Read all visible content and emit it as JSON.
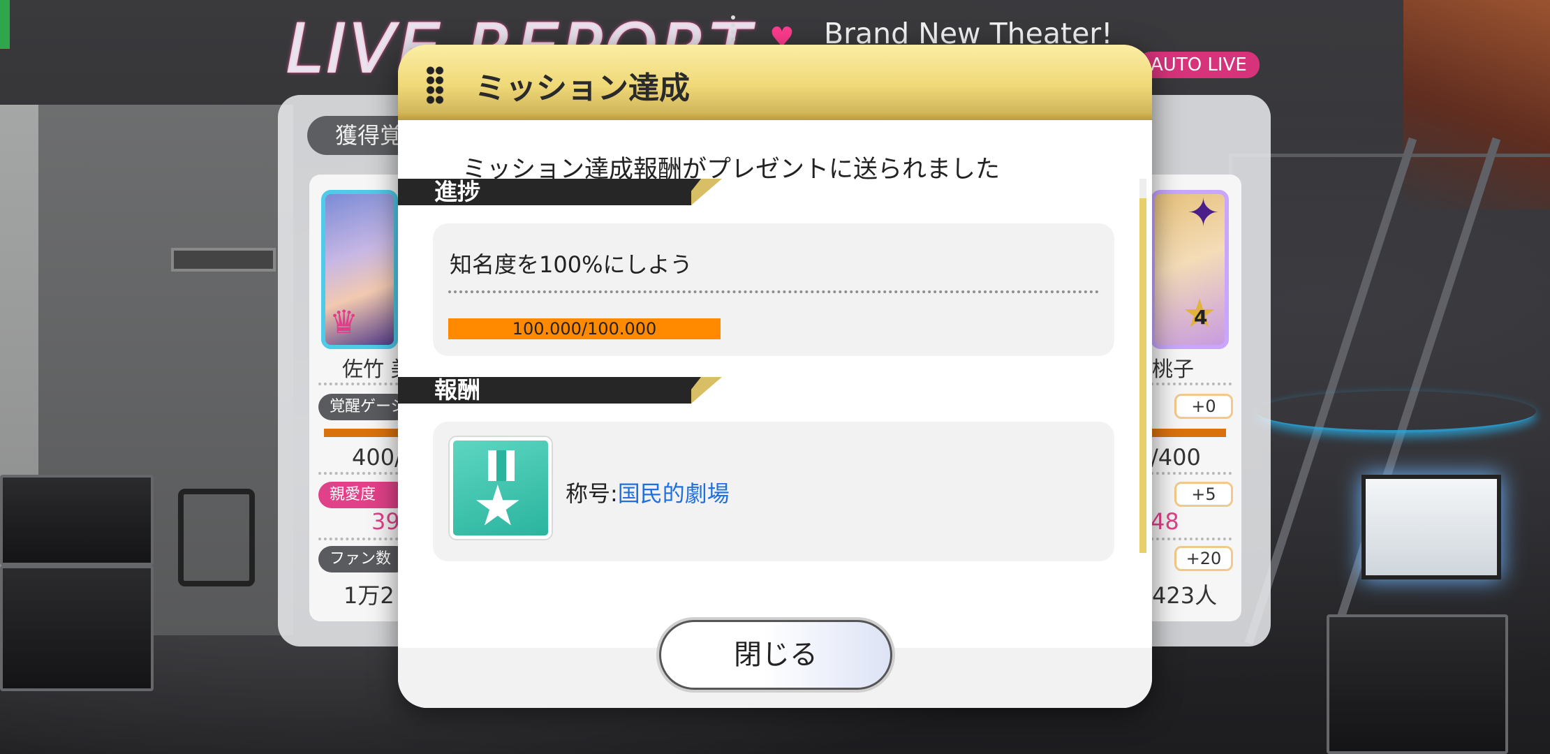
{
  "background": {
    "live_title": "LIVE REPORT",
    "song_title": "Brand New Theater!",
    "auto_badge": "AUTO LIVE",
    "acquired_tab": "獲得覚",
    "left_card": {
      "name": "佐竹 美",
      "gauge_label": "覚醒ゲージ",
      "gauge_value": "400/",
      "affection_label": "親愛度",
      "affection_value": "39",
      "fans_label": "ファン数",
      "fans_value": "1万2"
    },
    "right_card": {
      "name": "桃子",
      "gauge_plus": "+0",
      "gauge_value": "/400",
      "affection_plus": "+5",
      "affection_value": "48",
      "fans_plus": "+20",
      "fans_value": "423人",
      "rarity_star": "4"
    }
  },
  "modal": {
    "title": "ミッション達成",
    "message": "ミッション達成報酬がプレゼントに送られました",
    "progress_section": "進捗",
    "mission_text": "知名度を100%にしよう",
    "progress_text": "100.000/100.000",
    "progress_ratio": 1.0,
    "reward_section": "報酬",
    "reward_prefix": "称号:",
    "reward_value": "国民的劇場",
    "close_button": "閉じる"
  },
  "colors": {
    "header_gold": "#efd877",
    "progress_orange": "#ff8a00",
    "reward_link_blue": "#1f6fe0",
    "medal_teal": "#2ab49e",
    "auto_badge_pink": "#d6337b"
  },
  "icons": {
    "grip": "grip-dots-icon",
    "medal": "medal-star-icon",
    "heart": "heart-icon",
    "crown": "crown-icon"
  }
}
